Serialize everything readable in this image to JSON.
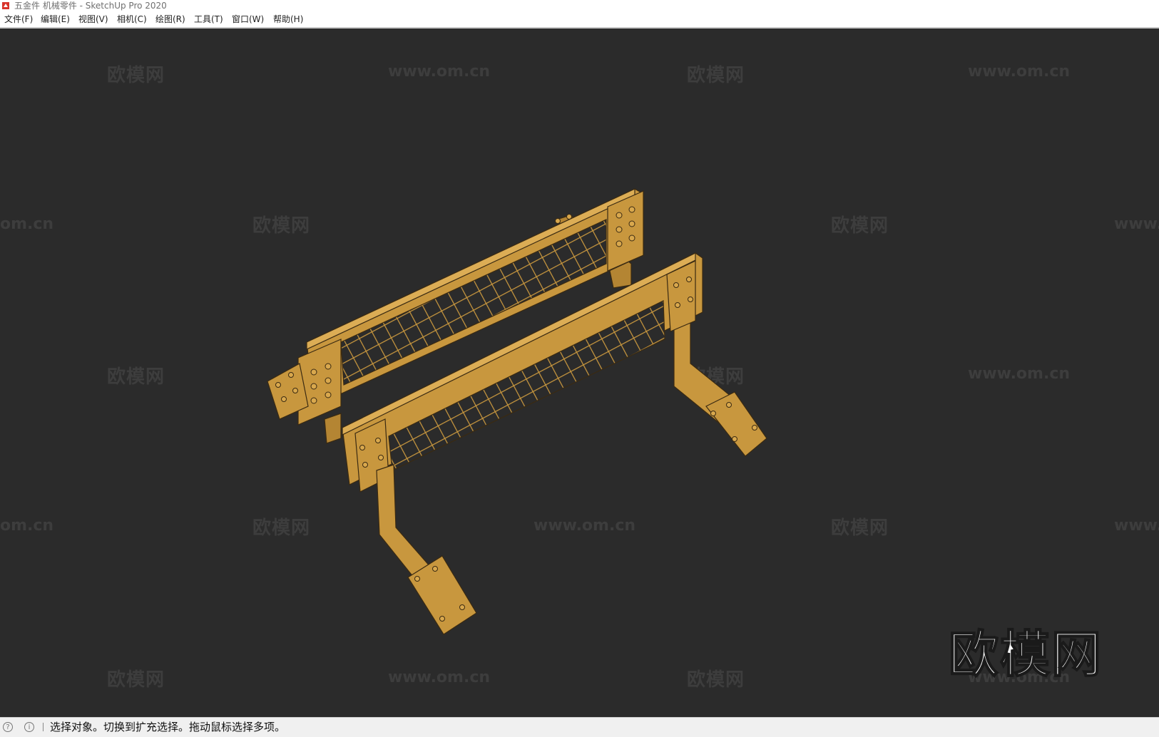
{
  "window": {
    "title": "五金件 机械零件 - SketchUp Pro 2020",
    "app_icon": "sketchup-icon"
  },
  "menu": {
    "items": [
      {
        "label": "文件(F)"
      },
      {
        "label": "编辑(E)"
      },
      {
        "label": "视图(V)"
      },
      {
        "label": "相机(C)"
      },
      {
        "label": "绘图(R)"
      },
      {
        "label": "工具(T)"
      },
      {
        "label": "窗口(W)"
      },
      {
        "label": "帮助(H)"
      }
    ]
  },
  "viewport": {
    "background": "#2b2b2b",
    "model_color": "#c8973e",
    "watermark_brand": "欧模网",
    "watermark_url": "www.om.cn",
    "watermark_url_partial": "om.cn",
    "watermark_url_partial_right": "www.",
    "logo_text": "欧模网"
  },
  "status": {
    "icons": [
      "geo-location-icon",
      "info-icon"
    ],
    "message": "选择对象。切换到扩充选择。拖动鼠标选择多项。"
  }
}
